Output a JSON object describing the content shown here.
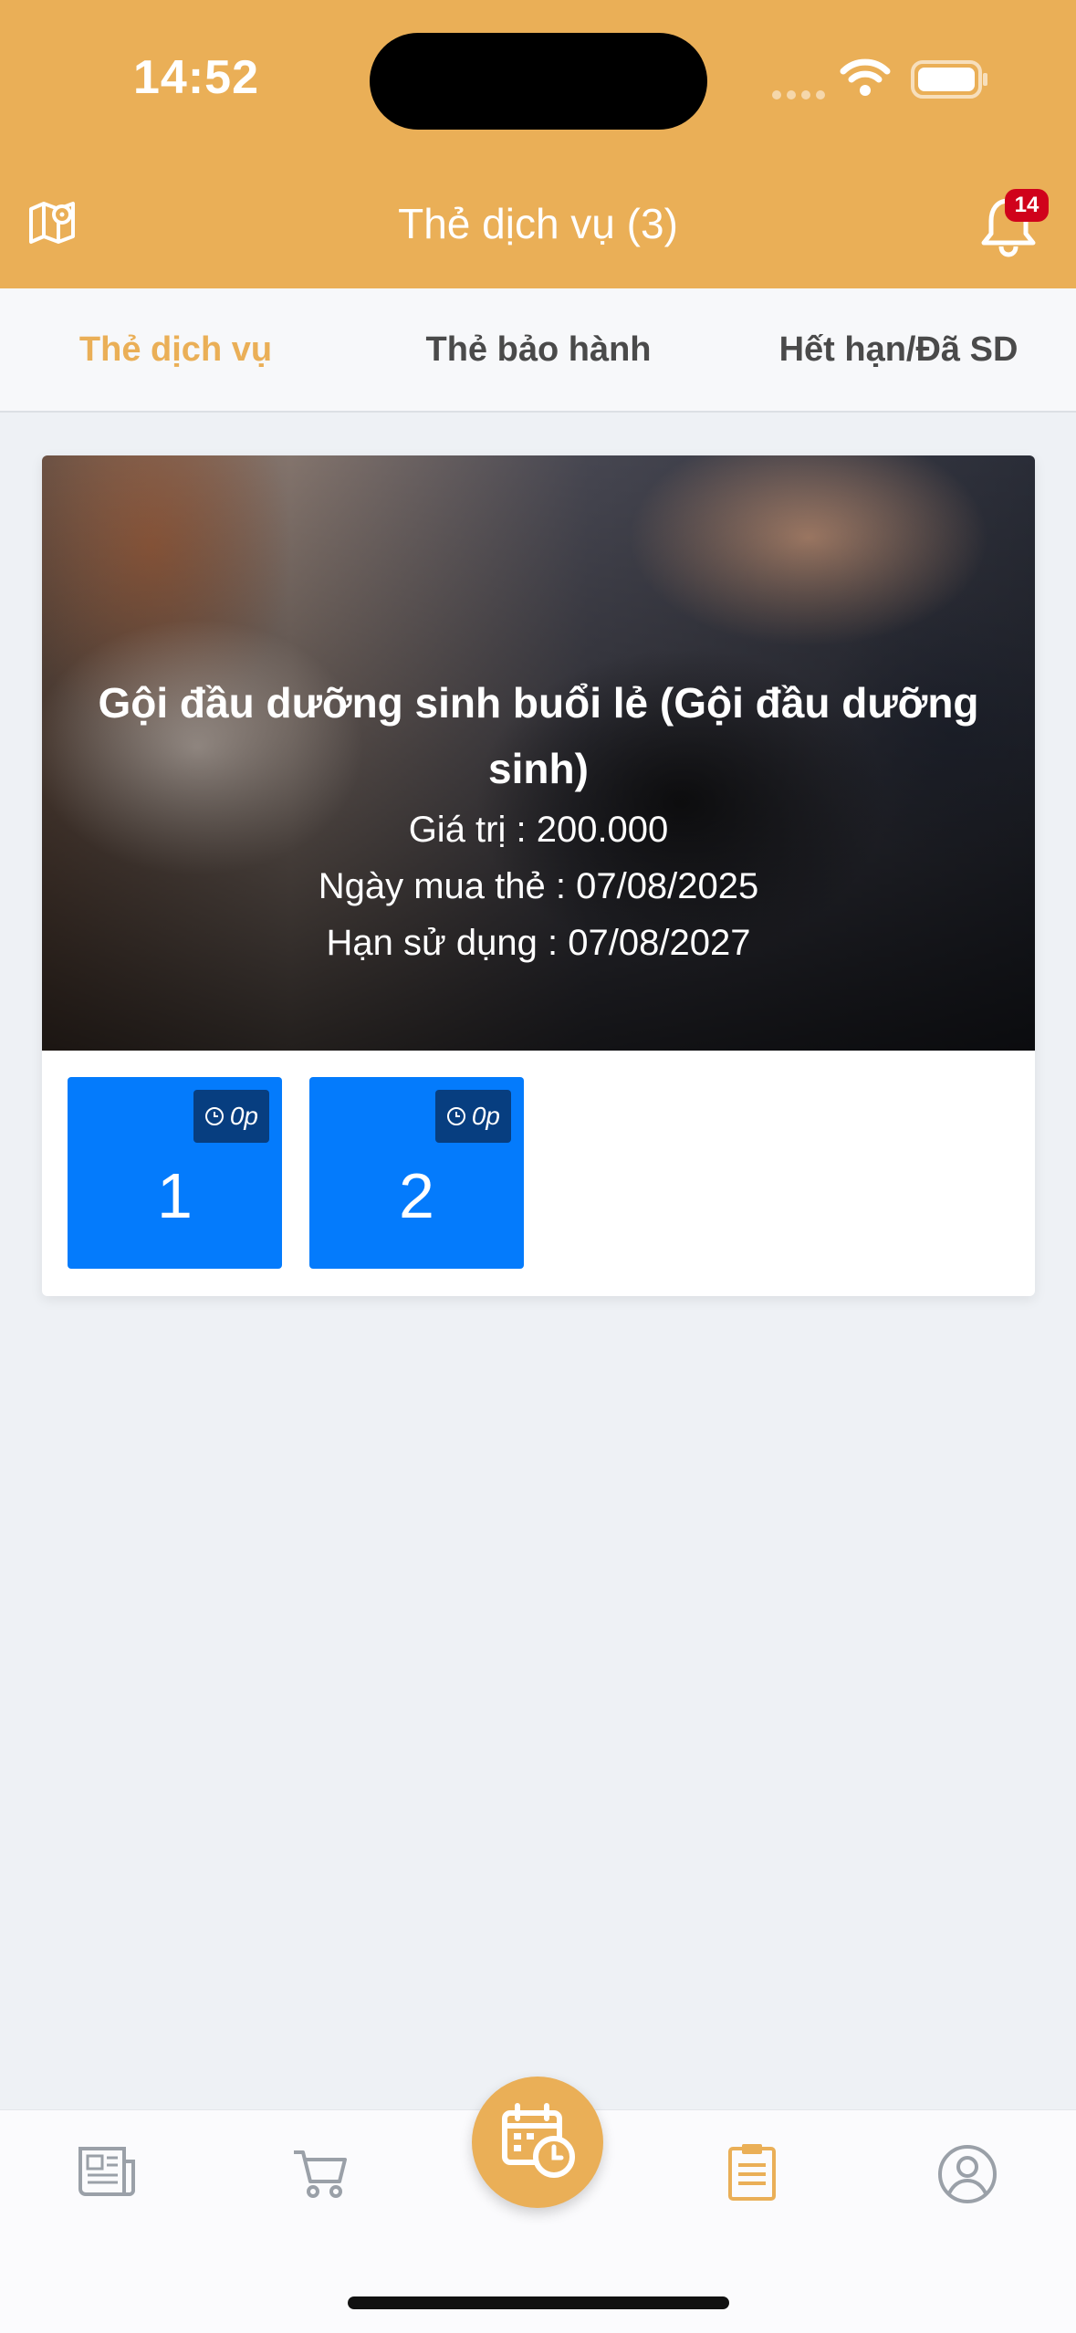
{
  "status_bar": {
    "time": "14:52"
  },
  "header": {
    "title": "Thẻ dịch vụ (3)",
    "notification_count": "14"
  },
  "tabs": [
    {
      "label": "Thẻ dịch vụ",
      "active": true
    },
    {
      "label": "Thẻ bảo hành",
      "active": false
    },
    {
      "label": "Hết hạn/Đã SD",
      "active": false
    }
  ],
  "card": {
    "title": "Gội đầu dưỡng sinh buổi lẻ (Gội đầu dưỡng sinh)",
    "value_line": "Giá trị : 200.000",
    "purchase_line": "Ngày mua thẻ : 07/08/2025",
    "expiry_line": "Hạn sử dụng : 07/08/2027",
    "sessions": [
      {
        "number": "1",
        "time": "0p"
      },
      {
        "number": "2",
        "time": "0p"
      }
    ]
  },
  "bottom_nav": [
    {
      "icon": "newspaper-icon",
      "active": false
    },
    {
      "icon": "cart-icon",
      "active": false
    },
    {
      "icon": "calendar-clock-icon",
      "active": false
    },
    {
      "icon": "clipboard-icon",
      "active": true
    },
    {
      "icon": "user-circle-icon",
      "active": false
    }
  ],
  "colors": {
    "accent": "#eaaf57",
    "session_bg": "#047bfc",
    "badge": "#d0021b"
  }
}
